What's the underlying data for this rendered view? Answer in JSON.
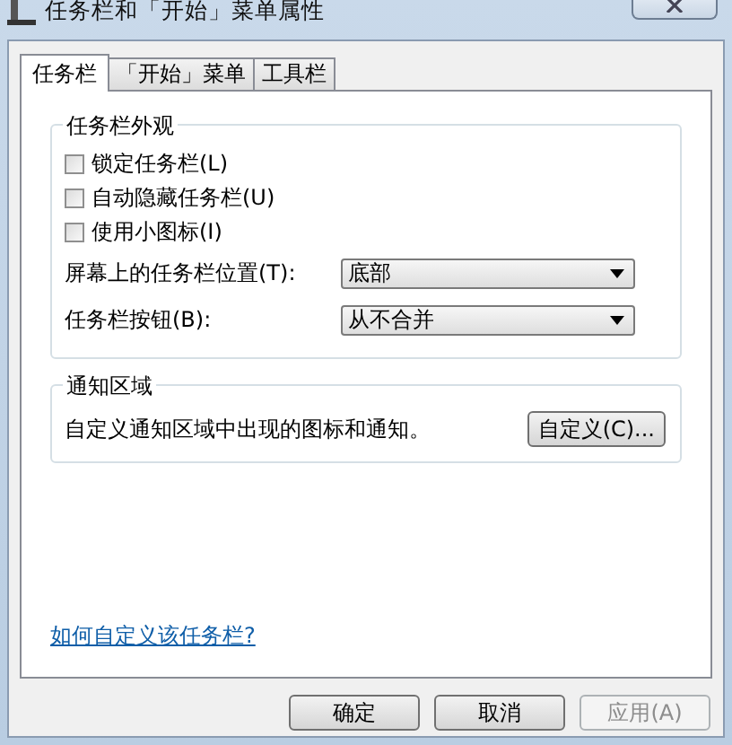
{
  "window": {
    "title": "任务栏和「开始」菜单属性"
  },
  "tabs": [
    {
      "label": "任务栏",
      "selected": true
    },
    {
      "label": "「开始」菜单",
      "selected": false
    },
    {
      "label": "工具栏",
      "selected": false
    }
  ],
  "appearance": {
    "title": "任务栏外观",
    "options": [
      {
        "label": "锁定任务栏(L)",
        "checked": false
      },
      {
        "label": "自动隐藏任务栏(U)",
        "checked": false
      },
      {
        "label": "使用小图标(I)",
        "checked": false
      }
    ],
    "dropdowns": [
      {
        "label": "屏幕上的任务栏位置(T):",
        "value": "底部"
      },
      {
        "label": "任务栏按钮(B):",
        "value": "从不合并"
      }
    ]
  },
  "notification_area": {
    "title": "通知区域",
    "description": "自定义通知区域中出现的图标和通知。",
    "button": "自定义(C)..."
  },
  "help_link": "如何自定义该任务栏?",
  "buttons": [
    {
      "label": "确定",
      "disabled": false
    },
    {
      "label": "取消",
      "disabled": false
    },
    {
      "label": "应用(A)",
      "disabled": true
    }
  ]
}
